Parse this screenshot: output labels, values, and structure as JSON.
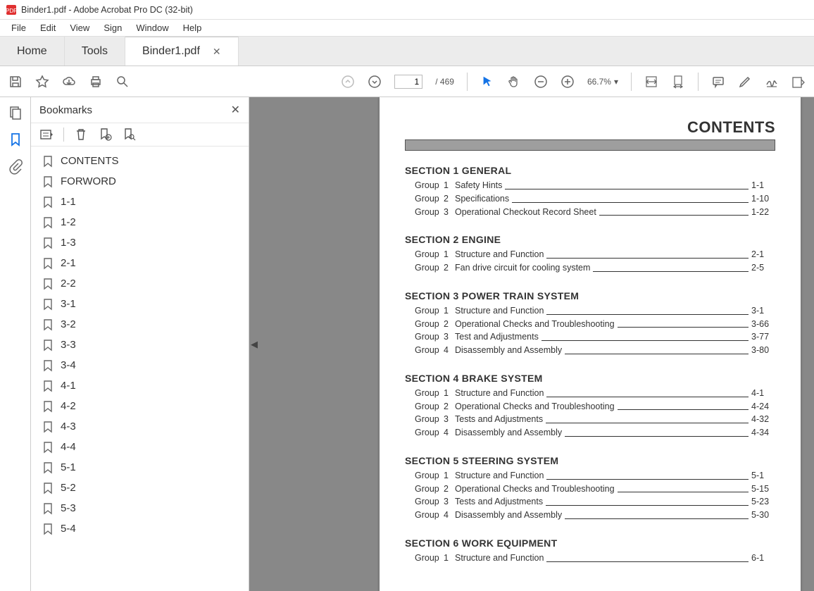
{
  "title_bar": "Binder1.pdf - Adobe Acrobat Pro DC (32-bit)",
  "menu": [
    "File",
    "Edit",
    "View",
    "Sign",
    "Window",
    "Help"
  ],
  "tabs": {
    "home": "Home",
    "tools": "Tools",
    "doc": "Binder1.pdf"
  },
  "toolbar": {
    "page_current": "1",
    "page_total": "/ 469",
    "zoom": "66.7%"
  },
  "panel": {
    "title": "Bookmarks"
  },
  "bookmarks": [
    "CONTENTS",
    "FORWORD",
    "1-1",
    "1-2",
    "1-3",
    "2-1",
    "2-2",
    "3-1",
    "3-2",
    "3-3",
    "3-4",
    "4-1",
    "4-2",
    "4-3",
    "4-4",
    "5-1",
    "5-2",
    "5-3",
    "5-4"
  ],
  "doc": {
    "heading": "CONTENTS",
    "sections": [
      {
        "title": "SECTION 1  GENERAL",
        "groups": [
          {
            "n": "1",
            "name": "Safety Hints",
            "page": "1-1"
          },
          {
            "n": "2",
            "name": "Specifications",
            "page": "1-10"
          },
          {
            "n": "3",
            "name": "Operational Checkout Record Sheet",
            "page": "1-22"
          }
        ]
      },
      {
        "title": "SECTION 2  ENGINE",
        "groups": [
          {
            "n": "1",
            "name": "Structure and Function",
            "page": "2-1"
          },
          {
            "n": "2",
            "name": "Fan drive circuit for cooling system",
            "page": "2-5"
          }
        ]
      },
      {
        "title": "SECTION 3  POWER TRAIN SYSTEM",
        "groups": [
          {
            "n": "1",
            "name": "Structure and Function",
            "page": "3-1"
          },
          {
            "n": "2",
            "name": "Operational Checks and Troubleshooting",
            "page": "3-66"
          },
          {
            "n": "3",
            "name": "Test and Adjustments",
            "page": "3-77"
          },
          {
            "n": "4",
            "name": "Disassembly and Assembly",
            "page": "3-80"
          }
        ]
      },
      {
        "title": "SECTION 4  BRAKE SYSTEM",
        "groups": [
          {
            "n": "1",
            "name": "Structure and Function",
            "page": "4-1"
          },
          {
            "n": "2",
            "name": "Operational Checks and Troubleshooting",
            "page": "4-24"
          },
          {
            "n": "3",
            "name": "Tests and Adjustments",
            "page": "4-32"
          },
          {
            "n": "4",
            "name": "Disassembly and Assembly",
            "page": "4-34"
          }
        ]
      },
      {
        "title": "SECTION 5  STEERING SYSTEM",
        "groups": [
          {
            "n": "1",
            "name": "Structure and Function",
            "page": "5-1"
          },
          {
            "n": "2",
            "name": "Operational Checks and Troubleshooting",
            "page": "5-15"
          },
          {
            "n": "3",
            "name": "Tests and Adjustments",
            "page": "5-23"
          },
          {
            "n": "4",
            "name": "Disassembly and Assembly",
            "page": "5-30"
          }
        ]
      },
      {
        "title": "SECTION 6  WORK EQUIPMENT",
        "groups": [
          {
            "n": "1",
            "name": "Structure and Function",
            "page": "6-1"
          }
        ]
      }
    ]
  }
}
